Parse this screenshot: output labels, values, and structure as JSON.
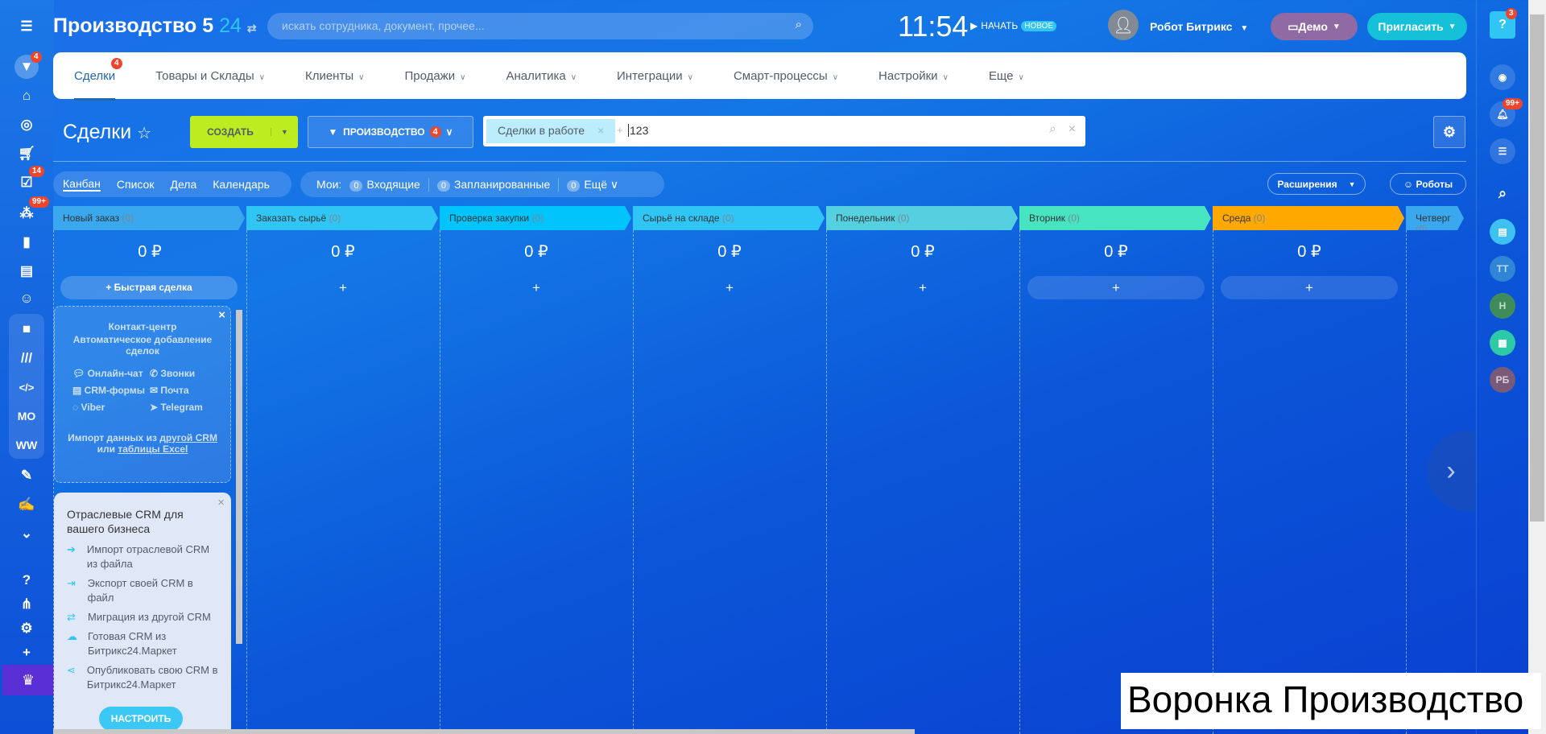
{
  "header": {
    "title": "Производство 5",
    "title_suffix": "24",
    "search_placeholder": "искать сотрудника, документ, прочее...",
    "time": "11:54",
    "start_label": "НАЧАТЬ",
    "new_badge": "НОВОЕ",
    "user_name": "Робот Битрикс",
    "demo_label": "Демо",
    "invite_label": "Пригласить"
  },
  "leftbar": {
    "badges": {
      "crm": "4",
      "tasks": "14",
      "groups": "99+"
    },
    "mo": "MO",
    "ww": "WW"
  },
  "nav": {
    "items": [
      {
        "label": "Сделки",
        "badge": "4"
      },
      {
        "label": "Товары и Склады"
      },
      {
        "label": "Клиенты"
      },
      {
        "label": "Продажи"
      },
      {
        "label": "Аналитика"
      },
      {
        "label": "Интеграции"
      },
      {
        "label": "Смарт-процессы"
      },
      {
        "label": "Настройки"
      },
      {
        "label": "Еще"
      }
    ]
  },
  "toolbar": {
    "page_title": "Сделки",
    "create_label": "СОЗДАТЬ",
    "pipeline_label": "ПРОИЗВОДСТВО",
    "pipeline_badge": "4",
    "filter_tag": "Сделки в работе",
    "filter_value": "123"
  },
  "views": {
    "tabs": [
      "Канбан",
      "Список",
      "Дела",
      "Календарь"
    ],
    "my_label": "Мои:",
    "counters": [
      {
        "count": "0",
        "label": "Входящие"
      },
      {
        "count": "0",
        "label": "Запланированные"
      },
      {
        "count": "0",
        "label": "Ещё"
      }
    ],
    "extensions_label": "Расширения",
    "robots_label": "Роботы"
  },
  "columns": [
    {
      "name": "Новый заказ",
      "count": "(0)",
      "sum": "0 ₽",
      "color": "#39a8ef"
    },
    {
      "name": "Заказать сырьё",
      "count": "(0)",
      "sum": "0 ₽",
      "color": "#2fc6f6"
    },
    {
      "name": "Проверка закупки",
      "count": "(0)",
      "sum": "0 ₽",
      "color": "#00c4fb"
    },
    {
      "name": "Сырьё на складе",
      "count": "(0)",
      "sum": "0 ₽",
      "color": "#2fc6f6"
    },
    {
      "name": "Понедельник",
      "count": "(0)",
      "sum": "0 ₽",
      "color": "#55d0e0"
    },
    {
      "name": "Вторник",
      "count": "(0)",
      "sum": "0 ₽",
      "color": "#47e4c2"
    },
    {
      "name": "Среда",
      "count": "(0)",
      "sum": "0 ₽",
      "color": "#ffa900"
    },
    {
      "name": "Четверг",
      "count": "(0)",
      "sum": "",
      "color": "#39a8ef"
    }
  ],
  "quick_deal": "Быстрая сделка",
  "contact_center": {
    "title": "Контакт-центр",
    "subtitle": "Автоматическое добавление сделок",
    "channels": [
      "Онлайн-чат",
      "Звонки",
      "CRM-формы",
      "Почта",
      "Viber",
      "Telegram"
    ],
    "import_text1": "Импорт данных из",
    "import_link1": "другой CRM",
    "import_text2": "или",
    "import_link2": "таблицы Excel"
  },
  "crm_box": {
    "title": "Отраслевые CRM для вашего бизнеса",
    "items": [
      "Импорт отраслевой CRM из файла",
      "Экспорт своей CRM в файл",
      "Миграция из другой CRM",
      "Готовая CRM из Битрикс24.Маркет",
      "Опубликовать свою CRM в Битрикс24.Маркет"
    ],
    "button": "НАСТРОИТЬ"
  },
  "rightbar": {
    "help_badge": "3",
    "notif_badge": "99+",
    "avatars": [
      "ТТ",
      "Н",
      "РБ"
    ]
  },
  "caption": "Воронка Производство"
}
